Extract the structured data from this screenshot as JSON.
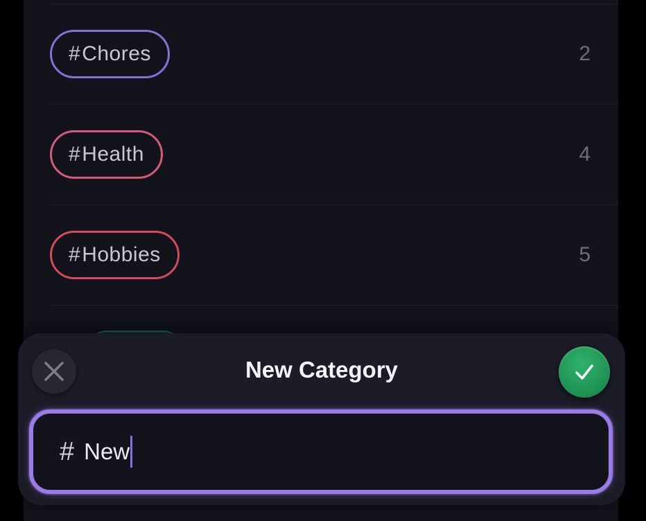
{
  "categories": [
    {
      "hash": "#",
      "name": "Chores",
      "count": "2",
      "color": "#8a6fd8"
    },
    {
      "hash": "#",
      "name": "Health",
      "count": "4",
      "color": "#d65a7a"
    },
    {
      "hash": "#",
      "name": "Hobbies",
      "count": "5",
      "color": "#d64a5c"
    }
  ],
  "sheet": {
    "title": "New Category",
    "close_icon": "close-icon",
    "confirm_icon": "checkmark-icon",
    "field_prefix": "#",
    "field_value": "New",
    "field_border_color": "#9b7be8",
    "confirm_color": "#22a05d"
  }
}
